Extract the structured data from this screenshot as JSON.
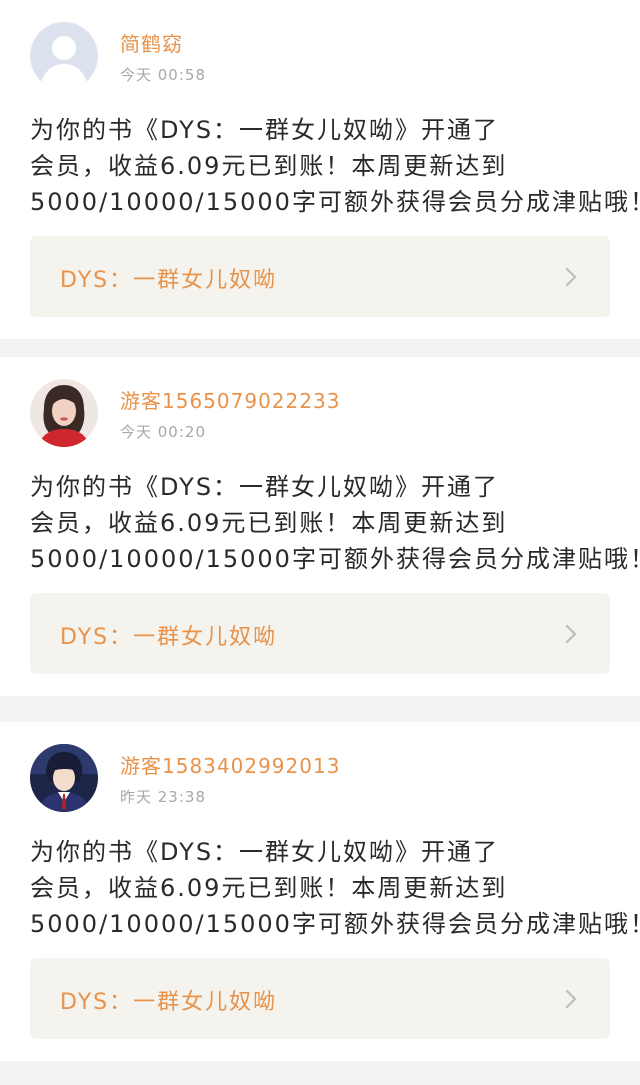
{
  "notifications": [
    {
      "username": "简鹤窈",
      "time": "今天  00:58",
      "avatar": "default-avatar",
      "message_lines": [
        "为你的书《DYS：一群女儿奴呦》开通了",
        "会员，收益6.09元已到账！本周更新达到",
        "5000/10000/15000字可额外获得会员分成津贴哦！"
      ],
      "book_title": "DYS：一群女儿奴呦"
    },
    {
      "username": "游客1565079022233",
      "time": "今天  00:20",
      "avatar": "woman-photo-avatar",
      "message_lines": [
        "为你的书《DYS：一群女儿奴呦》开通了",
        "会员，收益6.09元已到账！本周更新达到",
        "5000/10000/15000字可额外获得会员分成津贴哦！"
      ],
      "book_title": "DYS：一群女儿奴呦"
    },
    {
      "username": "游客1583402992013",
      "time": "昨天  23:38",
      "avatar": "anime-character-avatar",
      "message_lines": [
        "为你的书《DYS：一群女儿奴呦》开通了",
        "会员，收益6.09元已到账！本周更新达到",
        "5000/10000/15000字可额外获得会员分成津贴哦！"
      ],
      "book_title": "DYS：一群女儿奴呦"
    }
  ],
  "colors": {
    "accent": "#e8924a",
    "time": "#a8a8a8",
    "link_bg": "#f4f3ed",
    "page_bg": "#f3f3f3"
  }
}
